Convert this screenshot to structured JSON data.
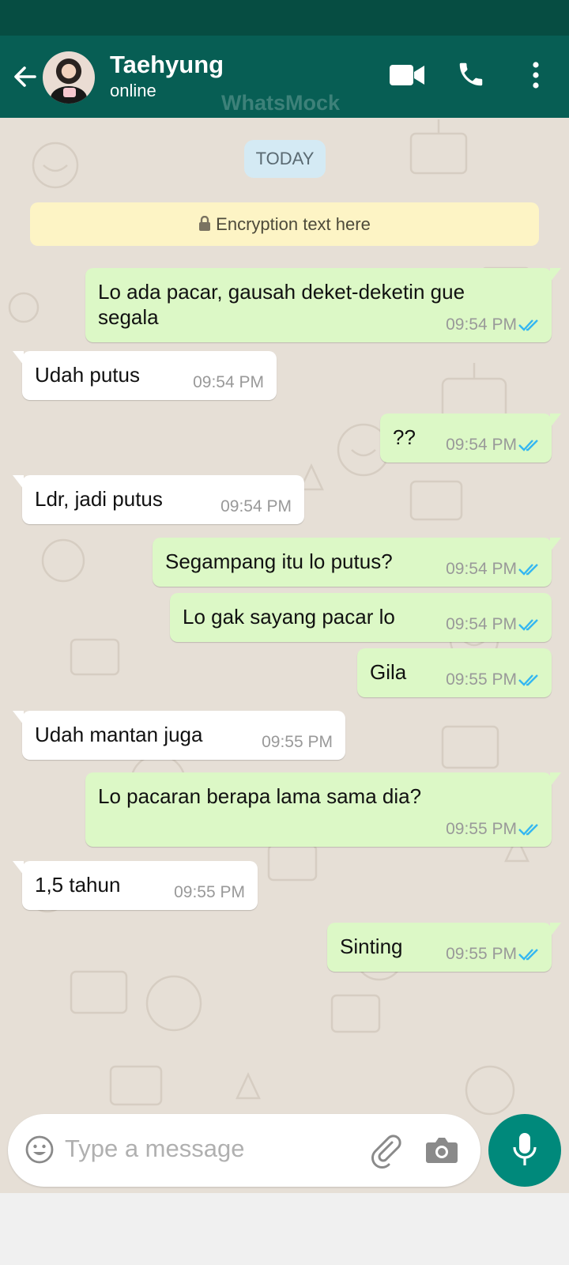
{
  "header": {
    "contact_name": "Taehyung",
    "contact_status": "online",
    "watermark": "WhatsMock",
    "icons": [
      "back-arrow-icon",
      "video-call-icon",
      "phone-call-icon",
      "more-vert-icon"
    ]
  },
  "chat": {
    "date_label": "TODAY",
    "encryption_text": "Encryption text here",
    "messages": [
      {
        "dir": "out",
        "text": "Lo ada pacar, gausah deket-deketin gue segala",
        "time": "09:54 PM",
        "status": "read"
      },
      {
        "dir": "in",
        "text": "Udah putus",
        "time": "09:54 PM"
      },
      {
        "dir": "out",
        "text": "??",
        "time": "09:54 PM",
        "status": "read"
      },
      {
        "dir": "in",
        "text": "Ldr, jadi putus",
        "time": "09:54 PM"
      },
      {
        "dir": "out",
        "text": "Segampang itu lo putus?",
        "time": "09:54 PM",
        "status": "read"
      },
      {
        "dir": "out",
        "text": "Lo gak sayang pacar lo",
        "time": "09:54 PM",
        "status": "read"
      },
      {
        "dir": "out",
        "text": "Gila",
        "time": "09:55 PM",
        "status": "read"
      },
      {
        "dir": "in",
        "text": "Udah mantan juga",
        "time": "09:55 PM"
      },
      {
        "dir": "out",
        "text": "Lo pacaran berapa lama sama dia?",
        "time": "09:55 PM",
        "status": "read"
      },
      {
        "dir": "in",
        "text": "1,5 tahun",
        "time": "09:55 PM"
      },
      {
        "dir": "out",
        "text": "Sinting",
        "time": "09:55 PM",
        "status": "read"
      }
    ]
  },
  "composer": {
    "placeholder": "Type a message",
    "icons": [
      "emoji-icon",
      "attach-icon",
      "camera-icon",
      "mic-icon"
    ]
  },
  "colors": {
    "header": "#075e54",
    "status_bar": "#064d42",
    "outgoing_bubble": "#dcf8c6",
    "incoming_bubble": "#ffffff",
    "read_ticks": "#34b7f1",
    "mic_button": "#00897b",
    "chat_background": "#e6dfd6"
  }
}
